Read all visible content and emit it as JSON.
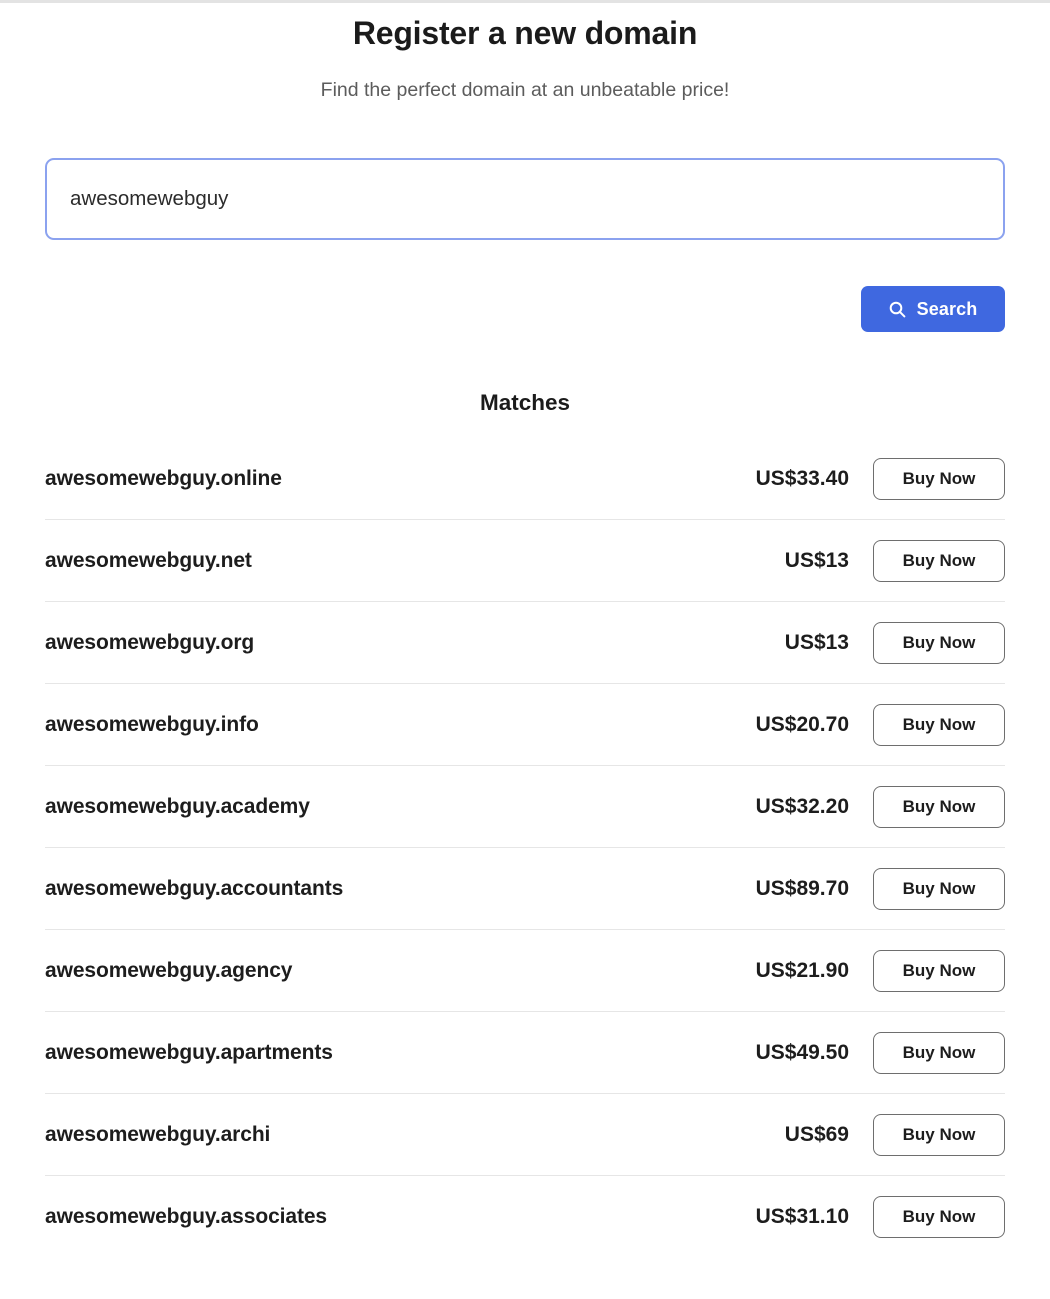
{
  "header": {
    "title": "Register a new domain",
    "subtitle": "Find the perfect domain at an unbeatable price!"
  },
  "search": {
    "value": "awesomewebguy",
    "placeholder": "",
    "button_label": "Search",
    "icon": "search-icon",
    "button_color": "#3f68e0",
    "input_border_color": "#8ba2ef"
  },
  "results": {
    "heading": "Matches",
    "buy_label": "Buy Now",
    "rows": [
      {
        "domain": "awesomewebguy.online",
        "price": "US$33.40",
        "buy_label": "Buy Now"
      },
      {
        "domain": "awesomewebguy.net",
        "price": "US$13",
        "buy_label": "Buy Now"
      },
      {
        "domain": "awesomewebguy.org",
        "price": "US$13",
        "buy_label": "Buy Now"
      },
      {
        "domain": "awesomewebguy.info",
        "price": "US$20.70",
        "buy_label": "Buy Now"
      },
      {
        "domain": "awesomewebguy.academy",
        "price": "US$32.20",
        "buy_label": "Buy Now"
      },
      {
        "domain": "awesomewebguy.accountants",
        "price": "US$89.70",
        "buy_label": "Buy Now"
      },
      {
        "domain": "awesomewebguy.agency",
        "price": "US$21.90",
        "buy_label": "Buy Now"
      },
      {
        "domain": "awesomewebguy.apartments",
        "price": "US$49.50",
        "buy_label": "Buy Now"
      },
      {
        "domain": "awesomewebguy.archi",
        "price": "US$69",
        "buy_label": "Buy Now"
      },
      {
        "domain": "awesomewebguy.associates",
        "price": "US$31.10",
        "buy_label": "Buy Now"
      }
    ]
  }
}
